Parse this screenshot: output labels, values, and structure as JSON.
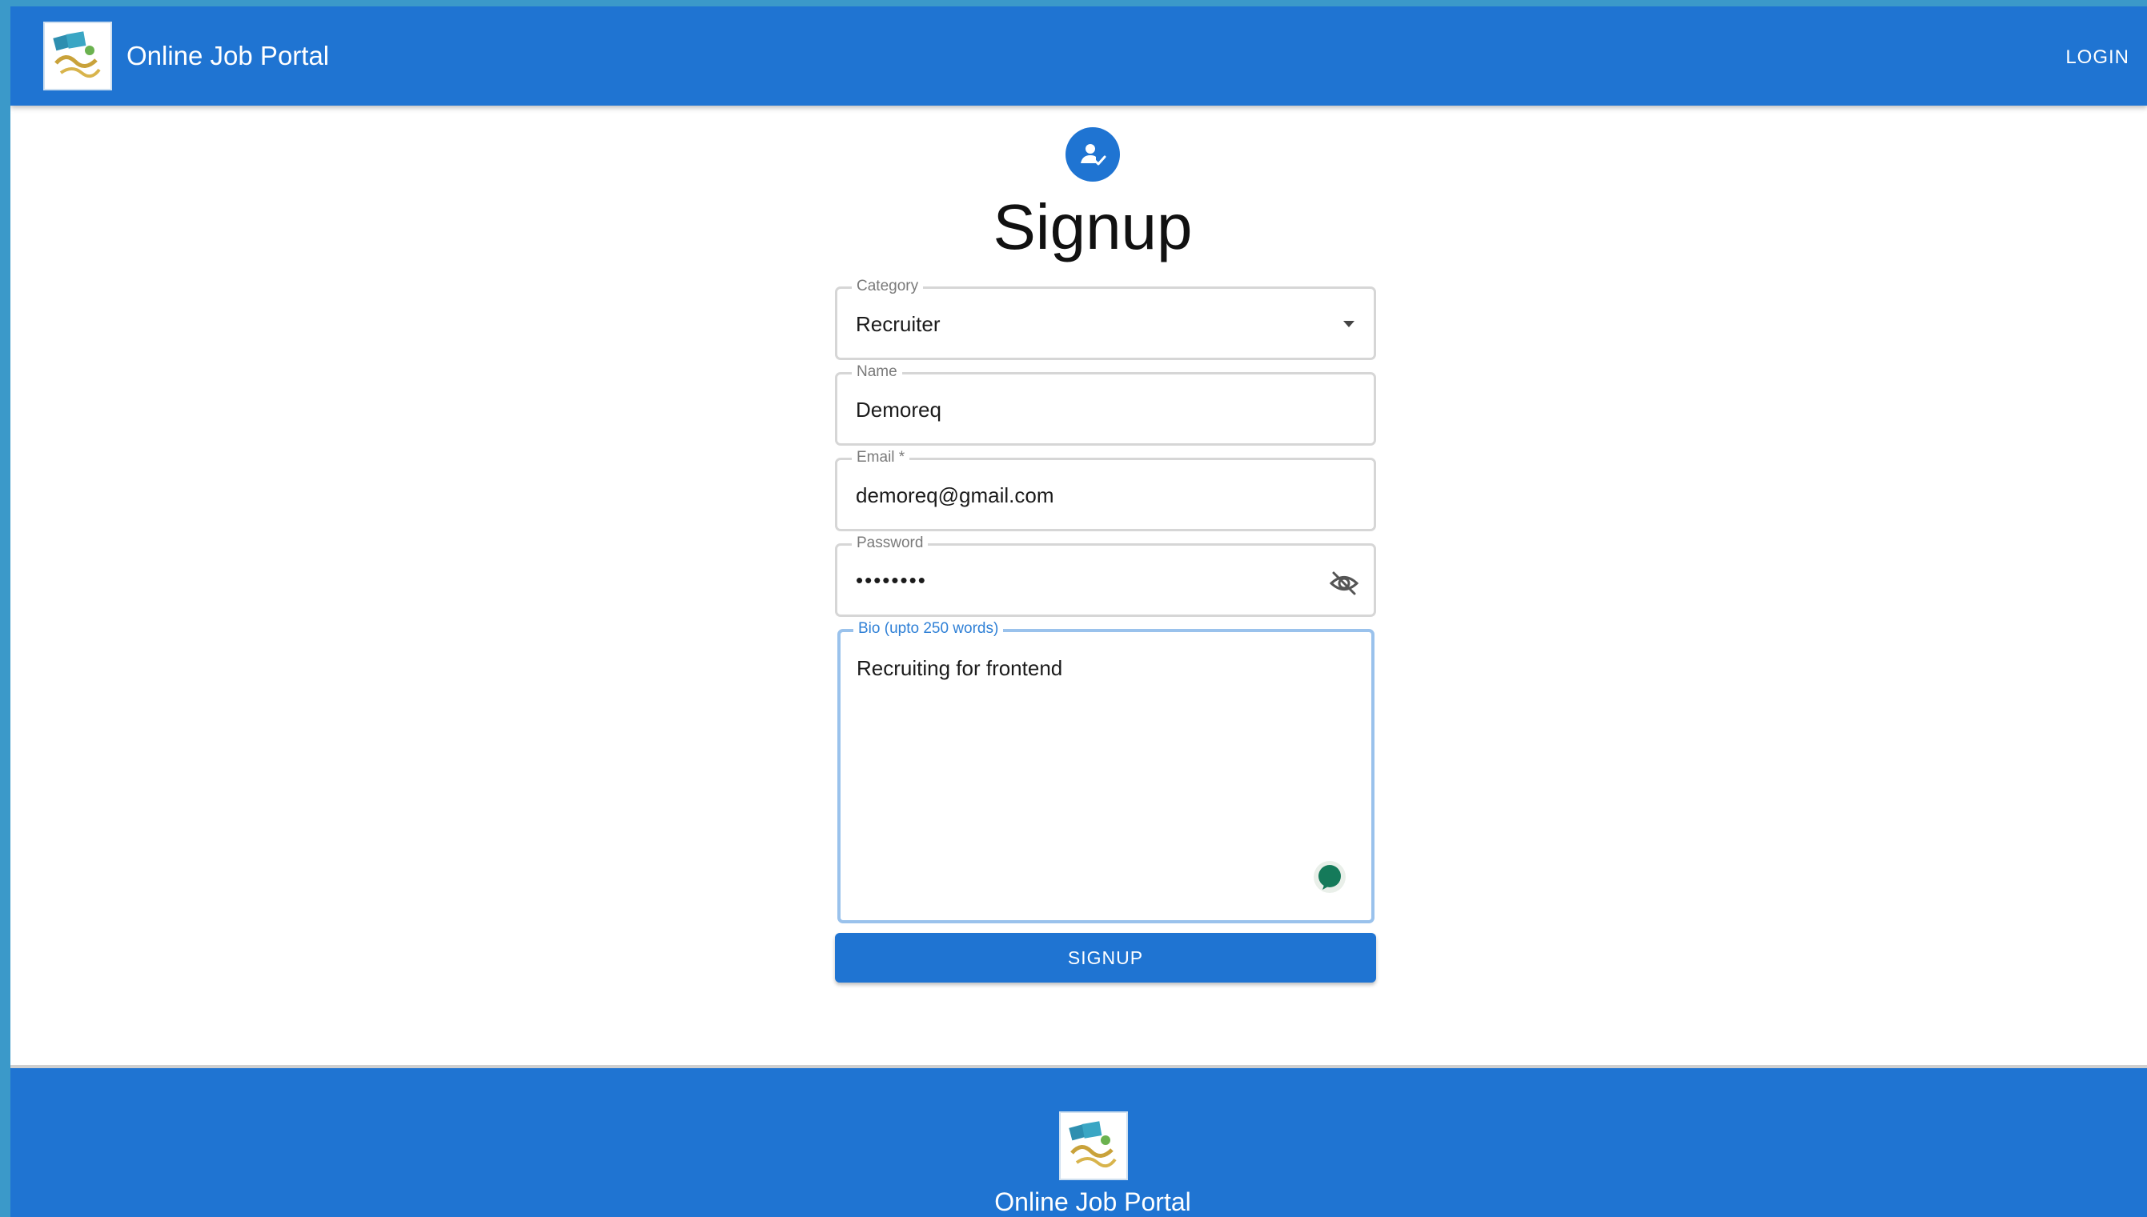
{
  "header": {
    "title": "Online Job Portal",
    "login_label": "LOGIN",
    "logo_icon": "job-logo-icon"
  },
  "form": {
    "avatar_icon": "person-check-icon",
    "title": "Signup",
    "category": {
      "label": "Category",
      "value": "Recruiter"
    },
    "name": {
      "label": "Name",
      "value": "Demoreq"
    },
    "email": {
      "label": "Email *",
      "value": "demoreq@gmail.com"
    },
    "password": {
      "label": "Password",
      "value": "••••••••",
      "visibility_icon": "eye-off-icon"
    },
    "bio": {
      "label": "Bio (upto 250 words)",
      "value": "Recruiting for frontend"
    },
    "submit_label": "SIGNUP"
  },
  "footer": {
    "title": "Online Job Portal",
    "logo_icon": "job-logo-icon"
  },
  "colors": {
    "primary": "#1f74d2",
    "focus_border": "#9ac2ec",
    "focus_label": "#2f80d6",
    "grammar_icon": "#157a5a"
  }
}
